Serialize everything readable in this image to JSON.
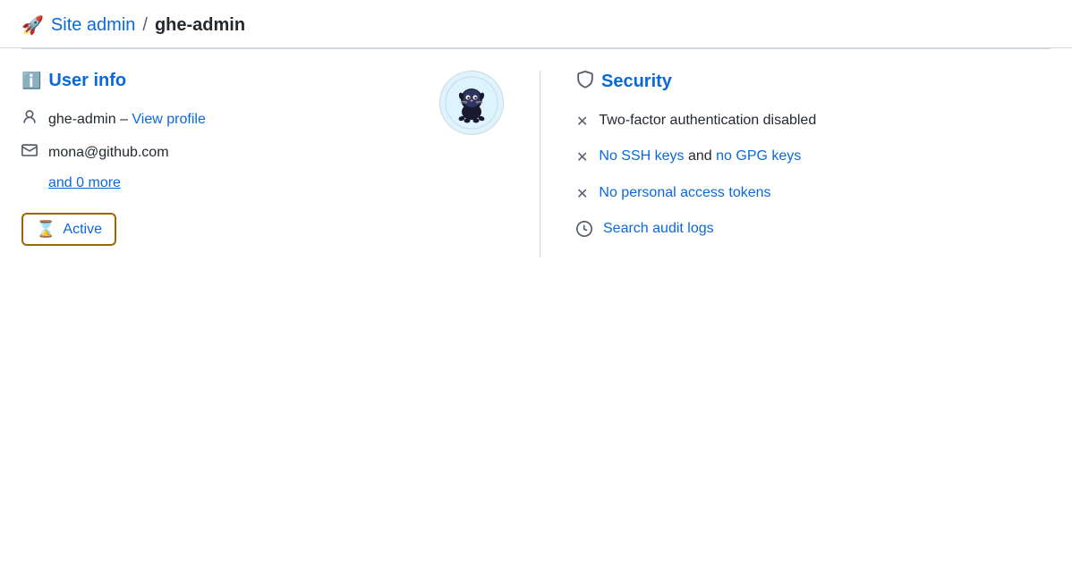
{
  "header": {
    "rocket_icon": "🚀",
    "site_admin_label": "Site admin",
    "separator": "/",
    "user_label": "ghe-admin"
  },
  "user_info": {
    "section_title": "User info",
    "username": "ghe-admin",
    "dash": "–",
    "view_profile_label": "View profile",
    "email": "mona@github.com",
    "and_more": "and 0 more",
    "active_label": "Active"
  },
  "security": {
    "section_title": "Security",
    "items": [
      {
        "id": "two-factor",
        "text": "Two-factor authentication disabled",
        "type": "plain"
      },
      {
        "id": "ssh-gpg",
        "link1": "No SSH keys",
        "middle": " and ",
        "link2": "no GPG keys",
        "type": "links"
      },
      {
        "id": "pat",
        "link1": "No personal access tokens",
        "type": "single-link"
      }
    ],
    "audit_label": "Search audit logs"
  }
}
